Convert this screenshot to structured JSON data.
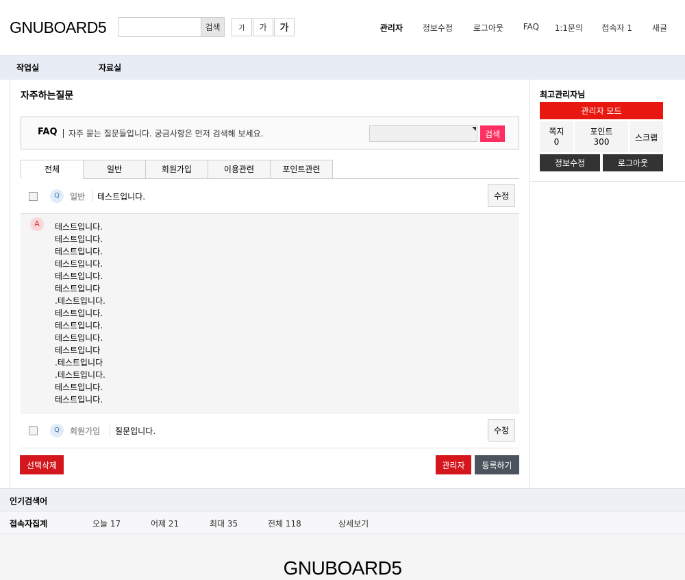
{
  "header": {
    "logo": "GNUBOARD5",
    "search_button": "검색",
    "search_placeholder": "",
    "font_small": "가",
    "font_mid": "가",
    "font_big": "가",
    "tnb": [
      "관리자",
      "정보수정",
      "로그아웃",
      "FAQ",
      "1:1문의",
      "접속자 1",
      "새글"
    ]
  },
  "gnb": [
    "작업실",
    "자료실"
  ],
  "main": {
    "page_title": "자주하는질문",
    "faq_head": {
      "title": "FAQ",
      "description": "자주 묻는 질문들입니다. 궁금사항은 먼저 검색해 보세요.",
      "search_button": "검색"
    },
    "tabs": [
      "전체",
      "일반",
      "회원가입",
      "이용관련",
      "포인트관련"
    ],
    "active_tab": "전체",
    "questions": [
      {
        "badge": "Q",
        "category": "일반",
        "question": "테스트입니다.",
        "edit": "수정"
      },
      {
        "badge": "Q",
        "category": "회원가입",
        "question": "질문입니다.",
        "edit": "수정"
      }
    ],
    "answer": {
      "badge": "A",
      "lines": [
        "테스트입니다.",
        "테스트입니다.",
        "테스트입니다.",
        "테스트입니다.",
        "테스트입니다.",
        "테스트입니다",
        ".테스트입니다.",
        "테스트입니다.",
        "테스트입니다.",
        "테스트입니다.",
        "테스트입니다",
        ".테스트입니다",
        ".테스트입니다.",
        "테스트입니다.",
        "테스트입니다."
      ]
    },
    "buttons": {
      "delete": "선택삭제",
      "admin": "관리자",
      "write": "등록하기"
    }
  },
  "aside": {
    "title": "최고관리자님",
    "admin_mode": "관리자 모드",
    "memo_label": "쪽지",
    "memo_value": "0",
    "point_label": "포인트",
    "point_value": "300",
    "scrap_label": "스크랩",
    "info_button": "정보수정",
    "logout_button": "로그아웃"
  },
  "popular": {
    "title": "인기검색어"
  },
  "visit": {
    "title": "접속자집계",
    "items": [
      "오늘   17",
      "어제   21",
      "최대   35",
      "전체   118"
    ],
    "detail": "상세보기"
  },
  "footer": {
    "logo": "GNUBOARD5"
  },
  "colors": {
    "red": "#d3171c",
    "pink": "#ff3061",
    "dark": "#333333",
    "nav_bg": "#e8edf5"
  }
}
